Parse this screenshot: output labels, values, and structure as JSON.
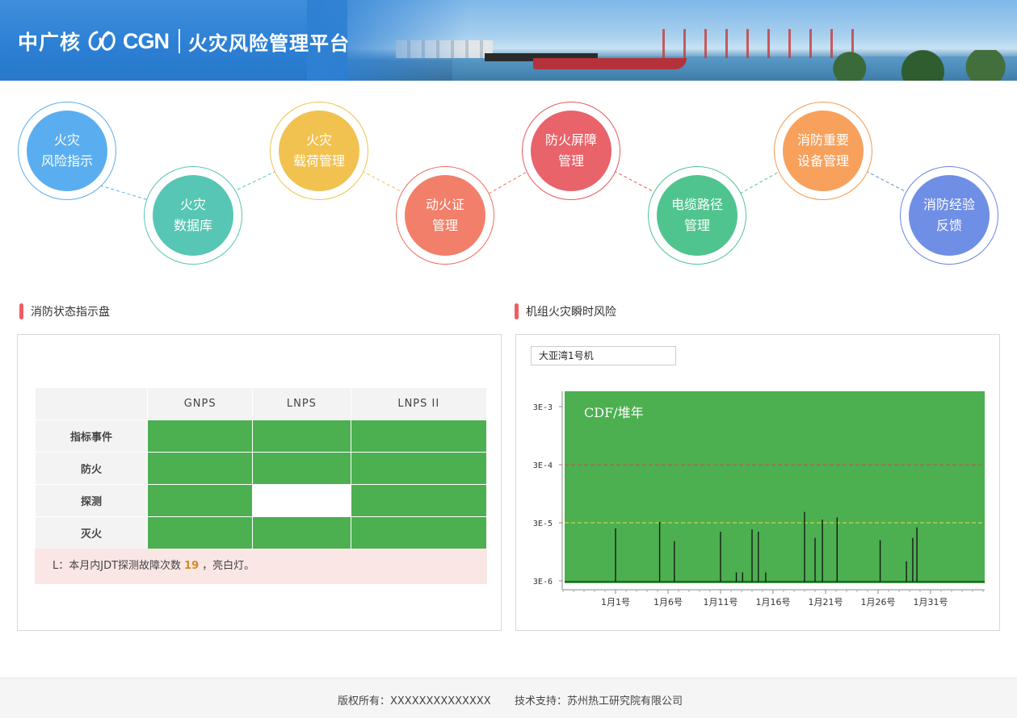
{
  "header": {
    "brand_cn": "中广核",
    "brand_en": "CGN",
    "title": "火灾风险管理平台"
  },
  "modules": [
    {
      "label": "火灾\n风险指示",
      "color": "#5aaeef",
      "border": "#5aaeef"
    },
    {
      "label": "火灾\n数据库",
      "color": "#57c6b4",
      "border": "#57c6b4"
    },
    {
      "label": "火灾\n载荷管理",
      "color": "#f2c250",
      "border": "#f2c250"
    },
    {
      "label": "动火证\n管理",
      "color": "#f27f6a",
      "border": "#ef6f5c"
    },
    {
      "label": "防火屏障\n管理",
      "color": "#e8636a",
      "border": "#e55a62"
    },
    {
      "label": "电缆路径\n管理",
      "color": "#50c48f",
      "border": "#50c48f"
    },
    {
      "label": "消防重要\n设备管理",
      "color": "#f7a15c",
      "border": "#f29a52"
    },
    {
      "label": "消防经验\n反馈",
      "color": "#6f8ee6",
      "border": "#6a86e0"
    }
  ],
  "status_panel": {
    "title": "消防状态指示盘",
    "columns": [
      "GNPS",
      "LNPS",
      "LNPS II"
    ],
    "rows": [
      {
        "label": "指标事件",
        "cells": [
          "green",
          "green",
          "green"
        ]
      },
      {
        "label": "防火",
        "cells": [
          "green",
          "green",
          "green"
        ]
      },
      {
        "label": "探测",
        "cells": [
          "green",
          "white",
          "green"
        ]
      },
      {
        "label": "灭火",
        "cells": [
          "green",
          "green",
          "green"
        ]
      }
    ],
    "note_prefix": "L：本月内JDT探测故障次数",
    "note_count": "19",
    "note_suffix": "，亮白灯。",
    "colors": {
      "green": "#4caf50",
      "white": "#ffffff"
    }
  },
  "risk_panel": {
    "title": "机组火灾瞬时风险",
    "unit_select": "大亚湾1号机"
  },
  "chart_data": {
    "type": "line",
    "title": "CDF/堆年",
    "xlabel": "",
    "ylabel": "",
    "y_scale": "log",
    "y_ticks": [
      "3E-3",
      "3E-4",
      "3E-5",
      "3E-6"
    ],
    "y_tick_values": [
      0.003,
      0.0003,
      3e-05,
      3e-06
    ],
    "ylim": [
      3e-06,
      0.004
    ],
    "x_ticks": [
      "1月1号",
      "1月6号",
      "1月11号",
      "1月16号",
      "1月21号",
      "1月26号",
      "1月31号"
    ],
    "x_tick_days": [
      1,
      6,
      11,
      16,
      21,
      26,
      31
    ],
    "xlim": [
      -4,
      36
    ],
    "background": "#4caf50",
    "reference_lines": [
      {
        "value": 0.0003,
        "color": "#c0504d",
        "style": "dashed"
      },
      {
        "value": 3e-05,
        "color": "#e6e04a",
        "style": "dashed"
      }
    ],
    "series": [
      {
        "color": "#111111",
        "spikes": [
          {
            "day": 1.0,
            "value": 2.4e-05
          },
          {
            "day": 5.2,
            "value": 3.1e-05
          },
          {
            "day": 6.6,
            "value": 1.45e-05
          },
          {
            "day": 11.0,
            "value": 2.1e-05
          },
          {
            "day": 12.5,
            "value": 4.2e-06
          },
          {
            "day": 13.1,
            "value": 4.2e-06
          },
          {
            "day": 14.0,
            "value": 2.3e-05
          },
          {
            "day": 14.6,
            "value": 2.1e-05
          },
          {
            "day": 15.3,
            "value": 4.2e-06
          },
          {
            "day": 19.0,
            "value": 4.6e-05
          },
          {
            "day": 20.0,
            "value": 1.65e-05
          },
          {
            "day": 20.7,
            "value": 3.4e-05
          },
          {
            "day": 22.1,
            "value": 3.7e-05
          },
          {
            "day": 26.2,
            "value": 1.5e-05
          },
          {
            "day": 28.7,
            "value": 6.5e-06
          },
          {
            "day": 29.3,
            "value": 1.65e-05
          },
          {
            "day": 29.7,
            "value": 2.5e-05
          }
        ]
      }
    ]
  },
  "footer": {
    "copyright": "版权所有：XXXXXXXXXXXXXX",
    "support": "技术支持：苏州热工研究院有限公司"
  }
}
